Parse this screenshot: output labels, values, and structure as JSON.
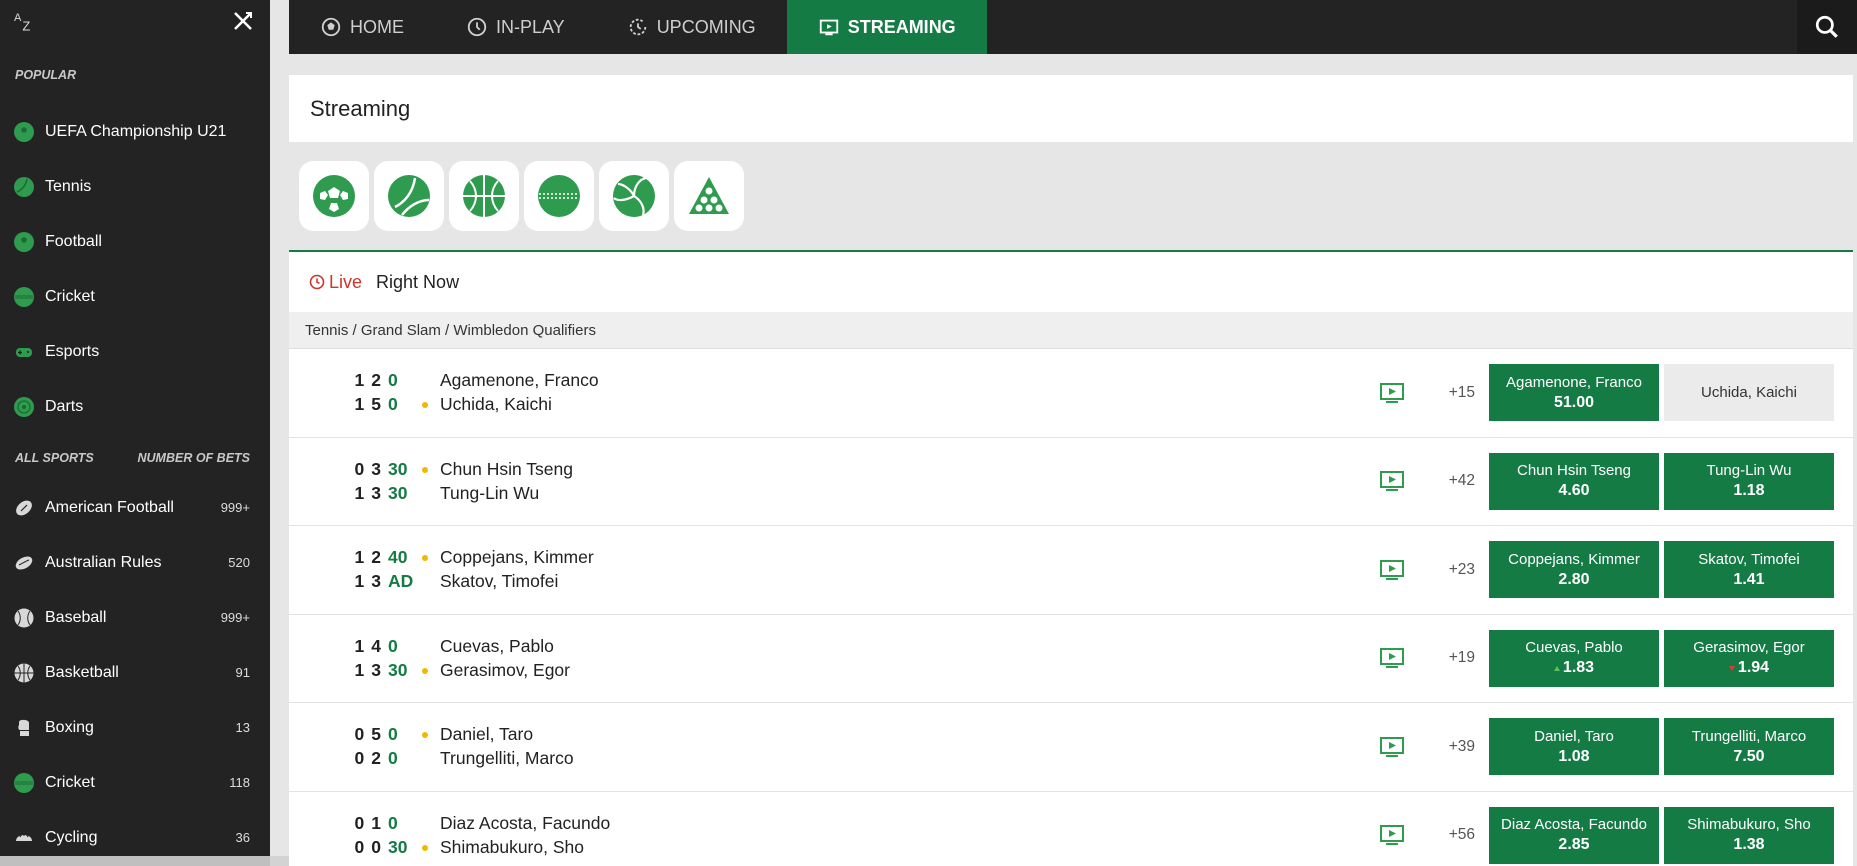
{
  "sidebar": {
    "az_label_a": "A",
    "az_label_z": "Z",
    "popular_label": "POPULAR",
    "popular": [
      {
        "label": "UEFA Championship U21",
        "icon": "football-icon"
      },
      {
        "label": "Tennis",
        "icon": "tennis-ball-icon"
      },
      {
        "label": "Football",
        "icon": "football-icon"
      },
      {
        "label": "Cricket",
        "icon": "cricket-ball-icon"
      },
      {
        "label": "Esports",
        "icon": "gamepad-icon"
      },
      {
        "label": "Darts",
        "icon": "dartboard-icon"
      }
    ],
    "all_sports_label": "ALL SPORTS",
    "number_of_bets_label": "NUMBER OF BETS",
    "sports": [
      {
        "label": "American Football",
        "count": "999+",
        "icon": "american-football-icon"
      },
      {
        "label": "Australian Rules",
        "count": "520",
        "icon": "aussie-rules-ball-icon"
      },
      {
        "label": "Baseball",
        "count": "999+",
        "icon": "baseball-icon"
      },
      {
        "label": "Basketball",
        "count": "91",
        "icon": "basketball-icon"
      },
      {
        "label": "Boxing",
        "count": "13",
        "icon": "boxing-glove-icon"
      },
      {
        "label": "Cricket",
        "count": "118",
        "icon": "cricket-ball-icon"
      },
      {
        "label": "Cycling",
        "count": "36",
        "icon": "cycling-helmet-icon"
      }
    ]
  },
  "nav": {
    "tabs": [
      {
        "label": "HOME",
        "icon": "football-home-icon"
      },
      {
        "label": "IN-PLAY",
        "icon": "clock-icon"
      },
      {
        "label": "UPCOMING",
        "icon": "refresh-clock-icon"
      },
      {
        "label": "STREAMING",
        "icon": "tv-play-icon"
      }
    ],
    "active": "STREAMING"
  },
  "page": {
    "title": "Streaming",
    "sport_filters": [
      "football-icon",
      "tennis-ball-icon",
      "basketball-icon",
      "cricket-ball-icon",
      "volleyball-icon",
      "snooker-icon"
    ],
    "live_label": "Live",
    "right_now_label": "Right Now",
    "competition": "Tennis / Grand Slam / Wimbledon Qualifiers"
  },
  "matches": [
    {
      "home": {
        "name": "Agamenone, Franco",
        "sets": [
          "1",
          "2"
        ],
        "points": "0",
        "serving": false
      },
      "away": {
        "name": "Uchida, Kaichi",
        "sets": [
          "1",
          "5"
        ],
        "points": "0",
        "serving": true
      },
      "more": "+15",
      "odds": [
        {
          "label": "Agamenone, Franco",
          "price": "51.00",
          "disabled": false,
          "trend": ""
        },
        {
          "label": "Uchida, Kaichi",
          "price": "",
          "disabled": true,
          "trend": ""
        }
      ]
    },
    {
      "home": {
        "name": "Chun Hsin Tseng",
        "sets": [
          "0",
          "3"
        ],
        "points": "30",
        "serving": true
      },
      "away": {
        "name": "Tung-Lin Wu",
        "sets": [
          "1",
          "3"
        ],
        "points": "30",
        "serving": false
      },
      "more": "+42",
      "odds": [
        {
          "label": "Chun Hsin Tseng",
          "price": "4.60",
          "disabled": false,
          "trend": ""
        },
        {
          "label": "Tung-Lin Wu",
          "price": "1.18",
          "disabled": false,
          "trend": ""
        }
      ]
    },
    {
      "home": {
        "name": "Coppejans, Kimmer",
        "sets": [
          "1",
          "2"
        ],
        "points": "40",
        "serving": true
      },
      "away": {
        "name": "Skatov, Timofei",
        "sets": [
          "1",
          "3"
        ],
        "points": "AD",
        "serving": false
      },
      "more": "+23",
      "odds": [
        {
          "label": "Coppejans, Kimmer",
          "price": "2.80",
          "disabled": false,
          "trend": ""
        },
        {
          "label": "Skatov, Timofei",
          "price": "1.41",
          "disabled": false,
          "trend": ""
        }
      ]
    },
    {
      "home": {
        "name": "Cuevas, Pablo",
        "sets": [
          "1",
          "4"
        ],
        "points": "0",
        "serving": false
      },
      "away": {
        "name": "Gerasimov, Egor",
        "sets": [
          "1",
          "3"
        ],
        "points": "30",
        "serving": true
      },
      "more": "+19",
      "odds": [
        {
          "label": "Cuevas, Pablo",
          "price": "1.83",
          "disabled": false,
          "trend": "up"
        },
        {
          "label": "Gerasimov, Egor",
          "price": "1.94",
          "disabled": false,
          "trend": "down"
        }
      ]
    },
    {
      "home": {
        "name": "Daniel, Taro",
        "sets": [
          "0",
          "5"
        ],
        "points": "0",
        "serving": true
      },
      "away": {
        "name": "Trungelliti, Marco",
        "sets": [
          "0",
          "2"
        ],
        "points": "0",
        "serving": false
      },
      "more": "+39",
      "odds": [
        {
          "label": "Daniel, Taro",
          "price": "1.08",
          "disabled": false,
          "trend": ""
        },
        {
          "label": "Trungelliti, Marco",
          "price": "7.50",
          "disabled": false,
          "trend": ""
        }
      ]
    },
    {
      "home": {
        "name": "Diaz Acosta, Facundo",
        "sets": [
          "0",
          "1"
        ],
        "points": "0",
        "serving": false
      },
      "away": {
        "name": "Shimabukuro, Sho",
        "sets": [
          "0",
          "0"
        ],
        "points": "30",
        "serving": true
      },
      "more": "+56",
      "odds": [
        {
          "label": "Diaz Acosta, Facundo",
          "price": "2.85",
          "disabled": false,
          "trend": ""
        },
        {
          "label": "Shimabukuro, Sho",
          "price": "1.38",
          "disabled": false,
          "trend": ""
        }
      ]
    }
  ],
  "colors": {
    "accent": "#147b45",
    "sidebar_bg": "#232323",
    "live": "#d0342c",
    "serve_dot": "#f0b800"
  }
}
